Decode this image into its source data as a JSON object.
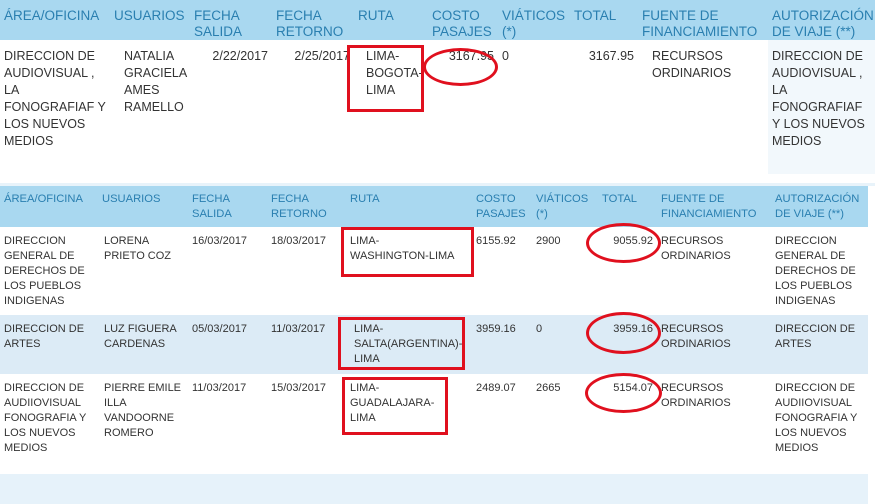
{
  "headers": {
    "area": "ÁREA/OFICINA",
    "usuarios": "USUARIOS",
    "fecha_salida": "FECHA SALIDA",
    "fecha_retorno": "FECHA RETORNO",
    "ruta": "RUTA",
    "costo_pasajes": "COSTO PASAJES",
    "viaticos": "VIÁTICOS (*)",
    "total": "TOTAL",
    "fuente": "FUENTE DE FINANCIAMIENTO",
    "autorizacion": "AUTORIZACIÓN DE VIAJE (**)"
  },
  "table1": {
    "rows": [
      {
        "area": "DIRECCION DE AUDIOVISUAL , LA FONOGRAFIAF Y LOS NUEVOS MEDIOS",
        "usuario": "NATALIA GRACIELA AMES RAMELLO",
        "fecha_salida": "2/22/2017",
        "fecha_retorno": "2/25/2017",
        "ruta": "LIMA-\nBOGOTA-\nLIMA",
        "costo": "3167.95",
        "viaticos": "0",
        "total": "3167.95",
        "fuente": "RECURSOS ORDINARIOS",
        "autorizacion": "DIRECCION DE AUDIOVISUAL , LA FONOGRAFIAF Y LOS NUEVOS MEDIOS"
      }
    ]
  },
  "table2": {
    "rows": [
      {
        "area": "DIRECCION GENERAL DE DERECHOS DE LOS PUEBLOS INDIGENAS",
        "usuario": "LORENA PRIETO COZ",
        "fecha_salida": "16/03/2017",
        "fecha_retorno": "18/03/2017",
        "ruta": "LIMA-\nWASHINGTON-LIMA",
        "costo": "6155.92",
        "viaticos": "2900",
        "total": "9055.92",
        "fuente": "RECURSOS ORDINARIOS",
        "autorizacion": "DIRECCION GENERAL DE DERECHOS DE LOS PUEBLOS INDIGENAS"
      },
      {
        "area": "DIRECCION DE ARTES",
        "usuario": "LUZ FIGUERA CARDENAS",
        "fecha_salida": "05/03/2017",
        "fecha_retorno": "11/03/2017",
        "ruta": "LIMA-\nSALTA(ARGENTINA)-\nLIMA",
        "costo": "3959.16",
        "viaticos": "0",
        "total": "3959.16",
        "fuente": "RECURSOS ORDINARIOS",
        "autorizacion": "DIRECCION DE ARTES"
      },
      {
        "area": "DIRECCION DE AUDIIOVISUAL FONOGRAFIA Y LOS NUEVOS MEDIOS",
        "usuario": "PIERRE EMILE ILLA VANDOORNE ROMERO",
        "fecha_salida": "11/03/2017",
        "fecha_retorno": "15/03/2017",
        "ruta": "LIMA-\nGUADALAJARA-\nLIMA",
        "costo": "2489.07",
        "viaticos": "2665",
        "total": "5154.07",
        "fuente": "RECURSOS ORDINARIOS",
        "autorizacion": "DIRECCION DE AUDIIOVISUAL FONOGRAFIA Y LOS NUEVOS MEDIOS"
      }
    ]
  },
  "colors": {
    "header_bg": "#a9d8f0",
    "header_text": "#2a7fb0",
    "row_alt_bg": "#dcebf6",
    "annotation": "#e0101e"
  }
}
